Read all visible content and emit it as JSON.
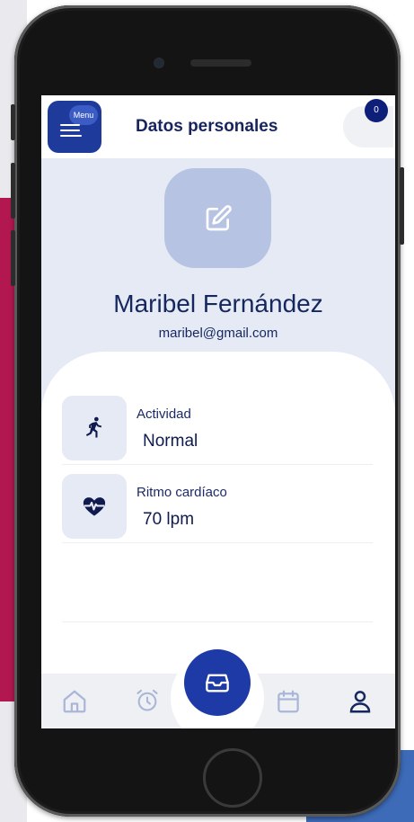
{
  "header": {
    "menu_label": "Menu",
    "title": "Datos personales",
    "notification_count": "0"
  },
  "profile": {
    "name": "Maribel Fernández",
    "email": "maribel@gmail.com"
  },
  "metrics": [
    {
      "label": "Actividad",
      "value": "Normal",
      "icon": "running-icon"
    },
    {
      "label": "Ritmo cardíaco",
      "value": "70 lpm",
      "icon": "heart-pulse-icon"
    }
  ],
  "bottom_nav": {
    "items": [
      "home-icon",
      "alarm-icon",
      "inbox-icon",
      "calendar-icon",
      "user-icon"
    ],
    "active": "user-icon"
  },
  "colors": {
    "primary": "#1e3aa6",
    "navy_text": "#15275f",
    "screen_bg": "#e6eaf4",
    "avatar_bg": "#b7c3e3",
    "inactive_icon": "#a9b6d8"
  }
}
